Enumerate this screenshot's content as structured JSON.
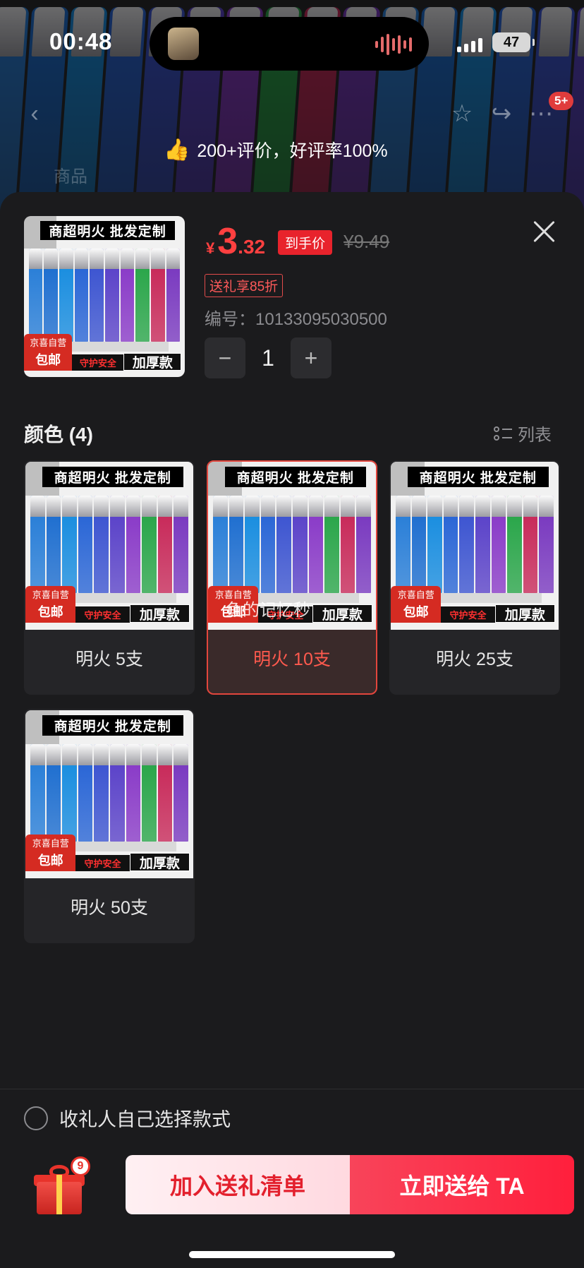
{
  "status_bar": {
    "time": "00:48",
    "battery": "47"
  },
  "background": {
    "nav_badge": "5+",
    "tab_label": "商品",
    "review_summary": "200+评价，好评率100%"
  },
  "product": {
    "banner_text": "商超明火  批发定制",
    "badge_top": "京喜自营",
    "badge_bottom": "包邮",
    "safe_text": "守护安全",
    "thick_text": "加厚款",
    "price_symbol": "¥",
    "price_int": "3",
    "price_dec": ".32",
    "price_tag": "到手价",
    "original_price": "¥9.49",
    "promo_tag": "送礼享85折",
    "sku_label": "编号：",
    "sku_value": "10133095030500",
    "quantity": "1",
    "minus": "−",
    "plus": "+"
  },
  "colors_section": {
    "title": "颜色 (4)",
    "list_toggle": "列表",
    "options": [
      {
        "label": "明火 5支",
        "selected": false
      },
      {
        "label": "明火 10支",
        "selected": true
      },
      {
        "label": "明火 25支",
        "selected": false
      },
      {
        "label": "明火 50支",
        "selected": false
      }
    ]
  },
  "watermark": "鱼的记忆秒",
  "footer": {
    "radio_label": "收礼人自己选择款式",
    "gift_count": "9",
    "add_button": "加入送礼清单",
    "send_button": "立即送给 TA"
  },
  "lighter_colors": [
    "#2a7fd8",
    "#1f6fd0",
    "#1a8ee0",
    "#2a66d6",
    "#3d55d1",
    "#5b43c9",
    "#8a3bc8",
    "#2aa64a",
    "#c82a5a",
    "#7a3ac0"
  ]
}
